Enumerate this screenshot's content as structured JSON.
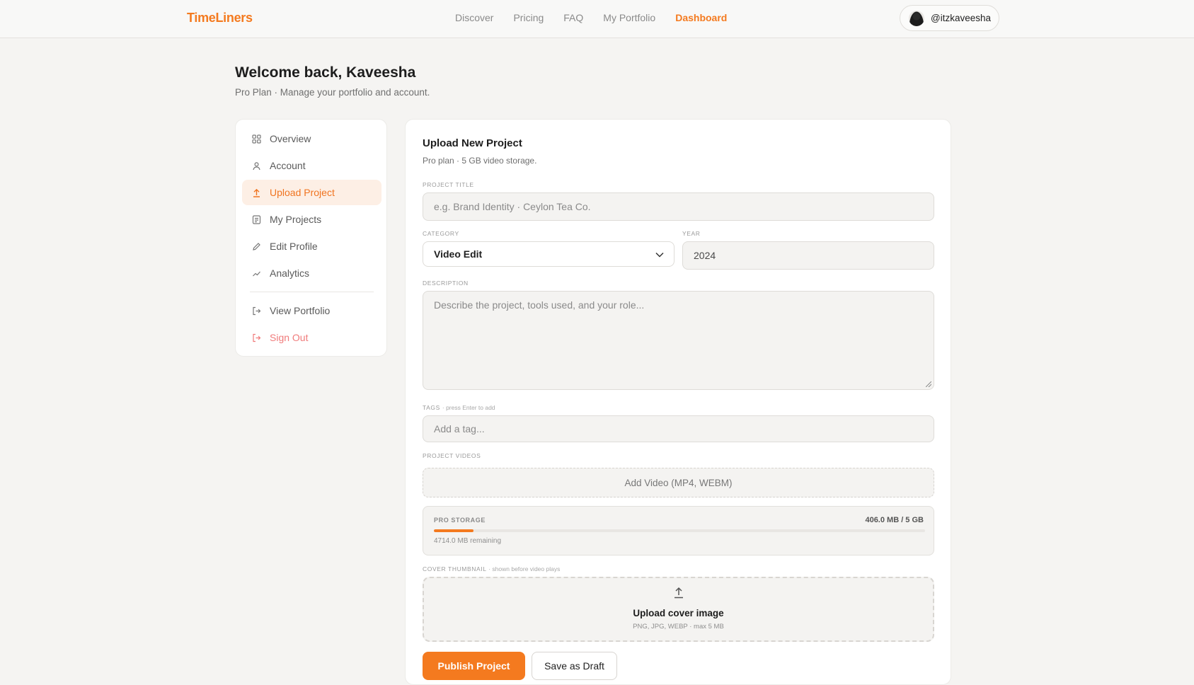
{
  "brand": {
    "name": "TimeLiners",
    "accent": "#f47a1f"
  },
  "nav": {
    "items": [
      "Discover",
      "Pricing",
      "FAQ",
      "My Portfolio",
      "Dashboard"
    ],
    "active": "Dashboard"
  },
  "user": {
    "handle": "@itzkaveesha"
  },
  "header": {
    "welcome": "Welcome back, Kaveesha",
    "subtitle": "Pro Plan · Manage your portfolio and account."
  },
  "sidebar": {
    "items": [
      {
        "label": "Overview",
        "icon": "grid-icon"
      },
      {
        "label": "Account",
        "icon": "user-icon"
      },
      {
        "label": "Upload Project",
        "icon": "upload-icon",
        "active": true
      },
      {
        "label": "My Projects",
        "icon": "document-icon"
      },
      {
        "label": "Edit Profile",
        "icon": "pencil-icon"
      },
      {
        "label": "Analytics",
        "icon": "trend-icon"
      }
    ],
    "secondary": [
      {
        "label": "View Portfolio",
        "icon": "external-link-icon"
      },
      {
        "label": "Sign Out",
        "icon": "sign-out-icon",
        "danger": true
      }
    ]
  },
  "form": {
    "title": "Upload New Project",
    "subtitle": "Pro plan · 5 GB video storage.",
    "project_title": {
      "label": "PROJECT TITLE",
      "placeholder": "e.g. Brand Identity · Ceylon Tea Co."
    },
    "category": {
      "label": "CATEGORY",
      "value": "Video Edit"
    },
    "year": {
      "label": "YEAR",
      "value": "2024"
    },
    "description": {
      "label": "DESCRIPTION",
      "placeholder": "Describe the project, tools used, and your role..."
    },
    "tags": {
      "label": "TAGS",
      "hint": "· press Enter to add",
      "placeholder": "Add a tag..."
    },
    "videos": {
      "label": "PROJECT VIDEOS",
      "add_label": "Add Video (MP4, WEBM)"
    },
    "storage": {
      "label": "PRO STORAGE",
      "usage": "406.0 MB / 5 GB",
      "used_fraction": 0.08,
      "remaining": "4714.0 MB remaining"
    },
    "cover": {
      "label": "COVER THUMBNAIL",
      "hint": "· shown before video plays",
      "title": "Upload cover image",
      "formats": "PNG, JPG, WEBP · max 5 MB"
    },
    "publish_label": "Publish Project",
    "draft_label": "Save as Draft"
  }
}
